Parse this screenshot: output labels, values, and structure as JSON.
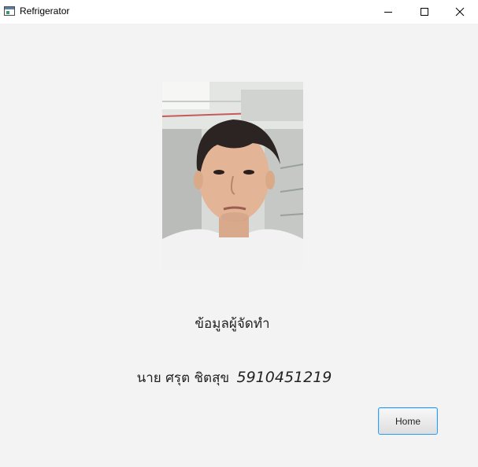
{
  "window": {
    "title": "Refrigerator",
    "icon": "app-window-icon",
    "controls": [
      "minimize-icon",
      "maximize-icon",
      "close-icon"
    ]
  },
  "main": {
    "photo_alt": "developer-photo",
    "heading": "ข้อมูลผู้จัดทำ",
    "author_name": "นาย ศรุต ชิตสุข",
    "student_id": "5910451219",
    "home_button": "Home"
  },
  "colors": {
    "background": "#f3f3f3",
    "titlebar": "#ffffff",
    "button_border": "#3c9ee0"
  }
}
